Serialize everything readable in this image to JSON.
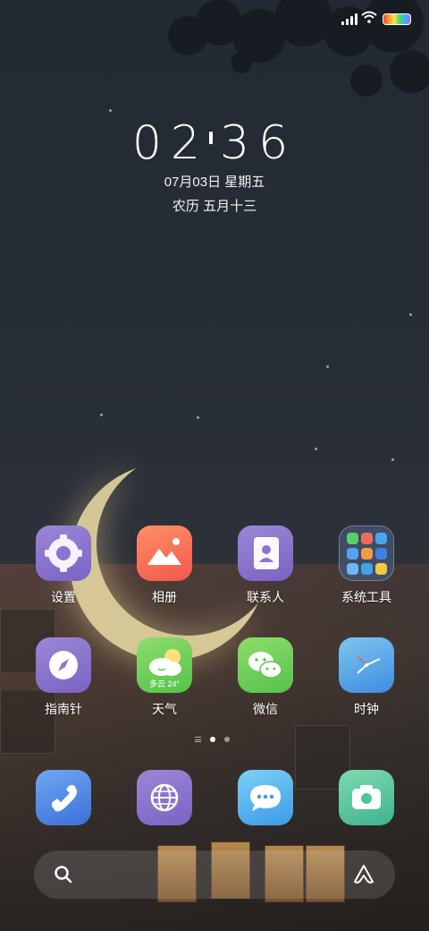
{
  "clock": {
    "hour": "02",
    "minute": "36",
    "date": "07月03日  星期五",
    "lunar": "农历 五月十三"
  },
  "apps_row1": [
    {
      "label": "设置",
      "icon": "settings-gear-icon"
    },
    {
      "label": "相册",
      "icon": "gallery-mountain-icon"
    },
    {
      "label": "联系人",
      "icon": "contacts-book-icon"
    },
    {
      "label": "系统工具",
      "icon": "folder-icon"
    }
  ],
  "apps_row2": [
    {
      "label": "指南针",
      "icon": "compass-icon"
    },
    {
      "label": "天气",
      "icon": "weather-cloud-icon",
      "weather_text": "多云 24°"
    },
    {
      "label": "微信",
      "icon": "wechat-icon"
    },
    {
      "label": "时钟",
      "icon": "clock-icon"
    }
  ],
  "dock": [
    {
      "icon": "phone-icon"
    },
    {
      "icon": "browser-globe-icon"
    },
    {
      "icon": "messages-icon"
    },
    {
      "icon": "camera-icon"
    }
  ],
  "pages": {
    "count": 2,
    "current": 1
  },
  "colors": {
    "accent": "#7a63c4"
  }
}
